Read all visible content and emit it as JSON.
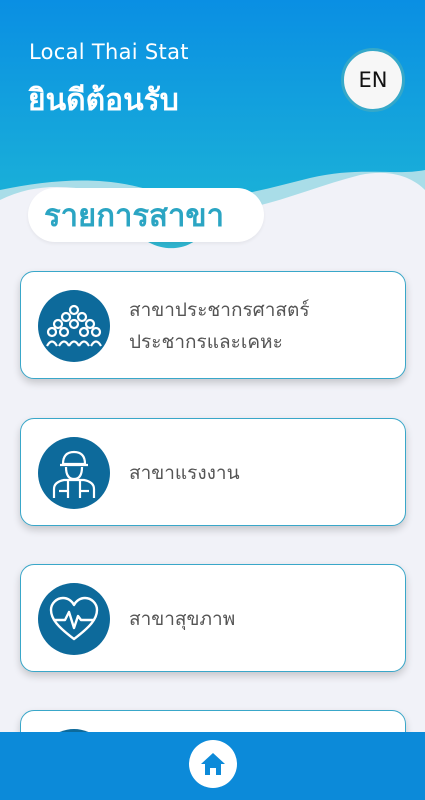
{
  "header": {
    "app_name": "Local Thai Stat",
    "welcome": "ยินดีต้อนรับ",
    "lang_button": "EN"
  },
  "section": {
    "title": "รายการสาขา"
  },
  "branches": [
    {
      "line1": "สาขาประชากรศาสตร์",
      "line2": "ประชากรและเคหะ",
      "icon": "population-icon"
    },
    {
      "line1": "สาขาแรงงาน",
      "line2": "",
      "icon": "worker-icon"
    },
    {
      "line1": "สาขาสุขภาพ",
      "line2": "",
      "icon": "heart-pulse-icon"
    }
  ],
  "nav": {
    "home_icon": "home-icon"
  },
  "colors": {
    "header_blue": "#0e8fe0",
    "accent_teal": "#2ba5c3",
    "icon_bg": "#0d6a9b",
    "nav_blue": "#0c8ad9"
  }
}
